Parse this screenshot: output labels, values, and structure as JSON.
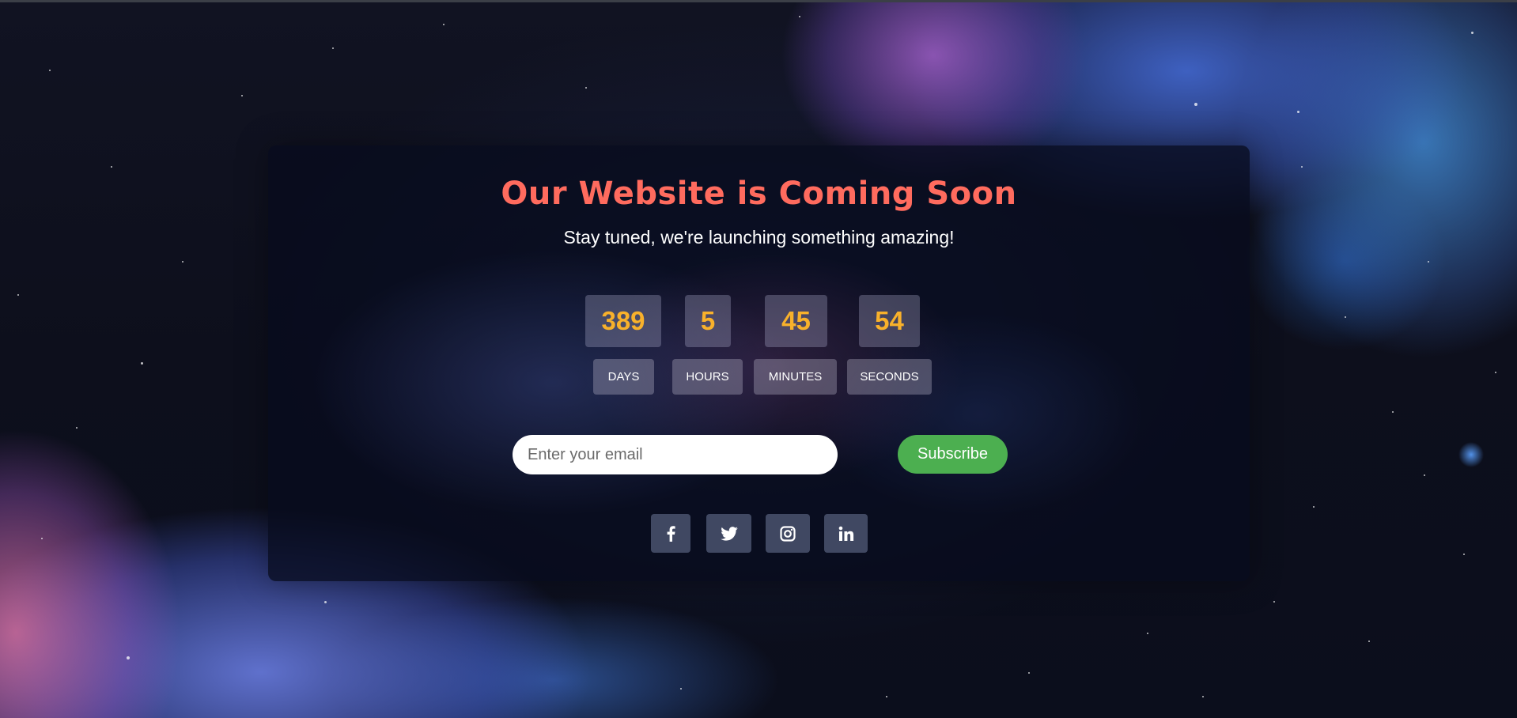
{
  "page": {
    "title": "Our Website is Coming Soon",
    "subtitle": "Stay tuned, we're launching something amazing!"
  },
  "countdown": {
    "days": {
      "value": "389",
      "label": "DAYS"
    },
    "hours": {
      "value": "5",
      "label": "HOURS"
    },
    "minutes": {
      "value": "45",
      "label": "MINUTES"
    },
    "seconds": {
      "value": "54",
      "label": "SECONDS"
    }
  },
  "subscribe": {
    "placeholder": "Enter your email",
    "button_label": "Subscribe"
  },
  "social": [
    {
      "name": "facebook",
      "icon": "facebook-icon"
    },
    {
      "name": "twitter",
      "icon": "twitter-icon"
    },
    {
      "name": "instagram",
      "icon": "instagram-icon"
    },
    {
      "name": "linkedin",
      "icon": "linkedin-icon"
    }
  ],
  "colors": {
    "title": "#ff6b5e",
    "countdown_numbers": "#f8b12b",
    "subscribe_button": "#4caf50",
    "text": "#ffffff"
  }
}
